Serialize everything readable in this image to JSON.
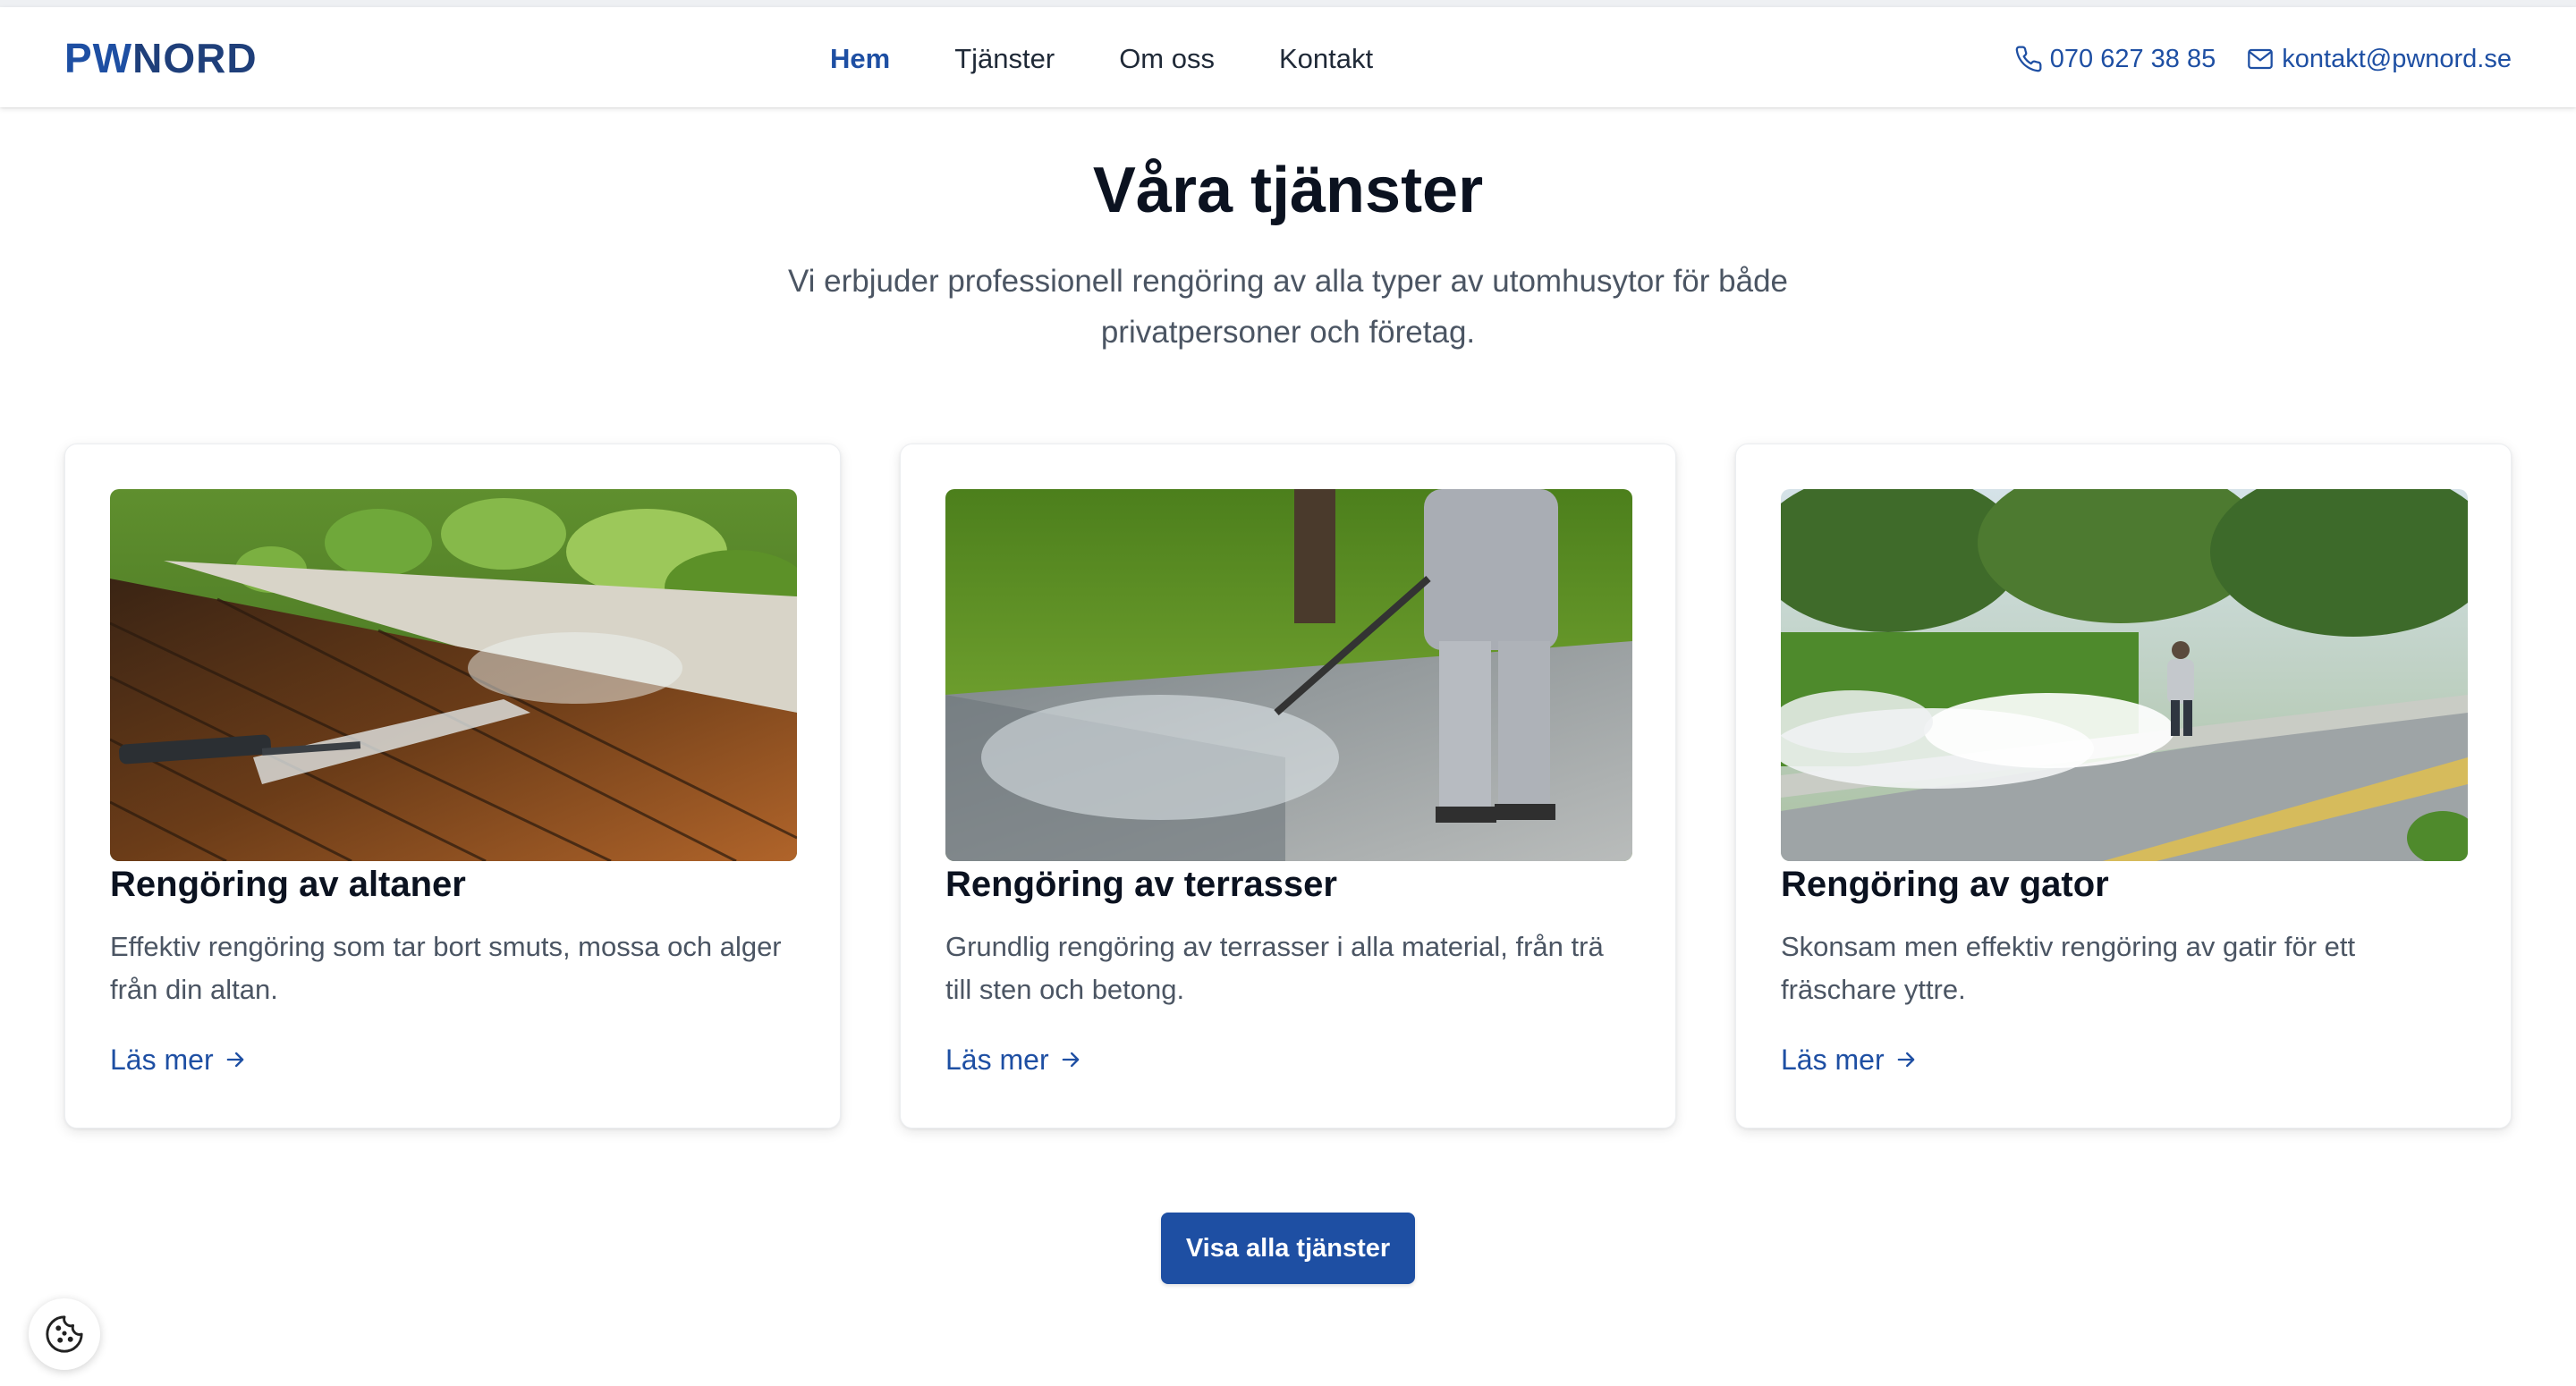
{
  "header": {
    "logo": {
      "part1": "PW",
      "part2": "NORD"
    },
    "nav": [
      {
        "label": "Hem",
        "active": true
      },
      {
        "label": "Tjänster",
        "active": false
      },
      {
        "label": "Om oss",
        "active": false
      },
      {
        "label": "Kontakt",
        "active": false
      }
    ],
    "phone": {
      "icon": "phone-icon",
      "text": "070 627 38 85"
    },
    "email": {
      "icon": "mail-icon",
      "text": "kontakt@pwnord.se"
    }
  },
  "hero": {
    "title": "Våra tjänster",
    "subtitle": "Vi erbjuder professionell rengöring av alla typer av utomhusytor för både privatpersoner och företag."
  },
  "services": [
    {
      "title": "Rengöring av altaner",
      "description": "Effektiv rengöring som tar bort smuts, mossa och alger från din altan.",
      "link": "Läs mer"
    },
    {
      "title": "Rengöring av terrasser",
      "description": "Grundlig rengöring av terrasser i alla material, från trä till sten och betong.",
      "link": "Läs mer"
    },
    {
      "title": "Rengöring av gator",
      "description": "Skonsam men effektiv rengöring av gatir för ett fräschare yttre.",
      "link": "Läs mer"
    }
  ],
  "cta": {
    "label": "Visa alla tjänster"
  },
  "cookie": {
    "icon": "cookie-icon"
  },
  "colors": {
    "brand": "#1e4fa3",
    "heading": "#0b1220",
    "body_text": "#4b5563"
  }
}
